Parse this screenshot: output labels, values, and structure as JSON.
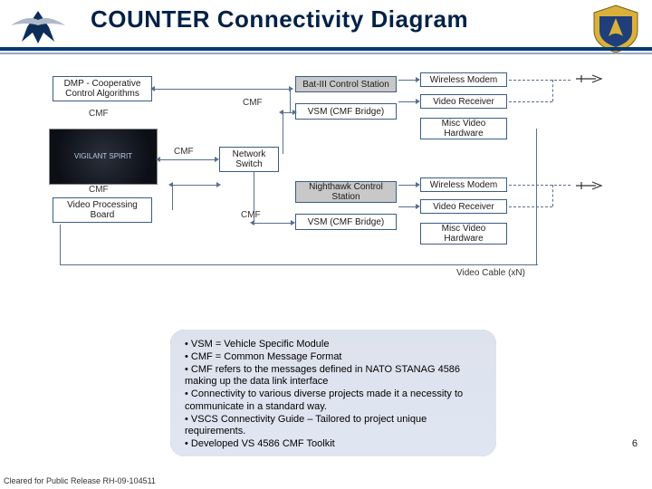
{
  "header": {
    "title": "COUNTER Connectivity Diagram"
  },
  "icons": {
    "left": "air-force-wings",
    "right": "shield-emblem"
  },
  "diagram": {
    "nodes": {
      "dmp": "DMP - Cooperative Control Algorithms",
      "video_proc": "Video Processing Board",
      "net_switch": "Network Switch",
      "bat3": "Bat-III Control Station",
      "vsm1": "VSM (CMF Bridge)",
      "nighthawk": "Nighthawk Control Station",
      "vsm2": "VSM (CMF Bridge)",
      "wm1": "Wireless Modem",
      "vr1": "Video Receiver",
      "mh1": "Misc Video Hardware",
      "wm2": "Wireless Modem",
      "vr2": "Video Receiver",
      "mh2": "Misc Video Hardware"
    },
    "labels": {
      "cmf1": "CMF",
      "cmf2": "CMF",
      "cmf3": "CMF",
      "cmf4": "CMF",
      "cmf5": "CMF",
      "vidcable": "Video Cable (xN)"
    },
    "images": {
      "vigilant": "VIGILANT SPIRIT"
    }
  },
  "callout": {
    "items": [
      "VSM = Vehicle Specific Module",
      "CMF = Common Message Format",
      "CMF refers to the messages defined in NATO STANAG 4586 making up the data link interface",
      "Connectivity to various diverse projects made it a necessity to communicate in a standard way.",
      "VSCS Connectivity Guide – Tailored to project unique requirements.",
      "Developed VS 4586 CMF Toolkit"
    ]
  },
  "footer": {
    "page": "6",
    "disclaimer": "Cleared for Public Release RH-09-104511"
  }
}
